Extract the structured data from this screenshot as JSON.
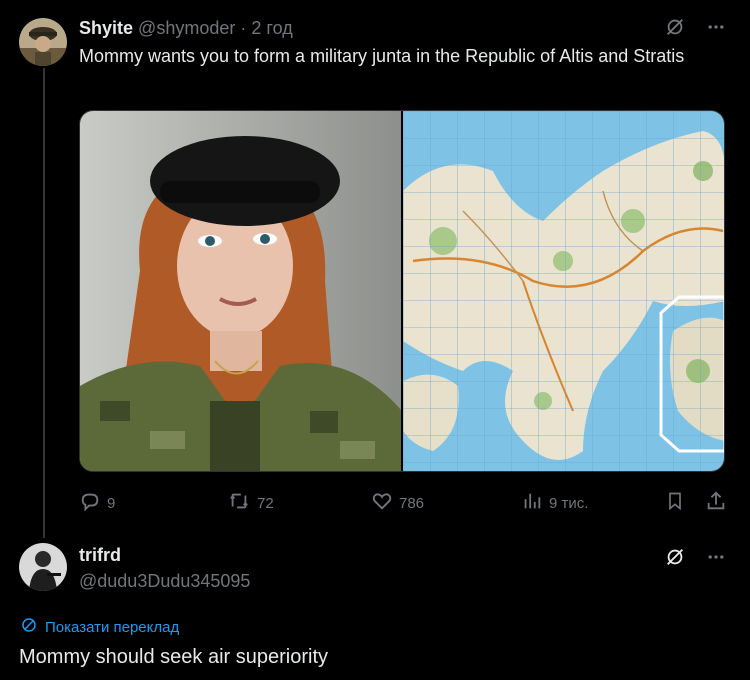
{
  "post": {
    "author_name": "Shyite",
    "author_handle": "@shymoder",
    "separator": "·",
    "time": "2 год",
    "text": "Mommy wants you to form a military junta in the Republic of Altis and Stratis",
    "media": [
      {
        "kind": "photo",
        "subject": "person-in-beret-and-camouflage"
      },
      {
        "kind": "map",
        "subject": "topographic-island-map"
      }
    ],
    "stats": {
      "replies": "9",
      "reposts": "72",
      "likes": "786",
      "views": "9 тис."
    }
  },
  "reply": {
    "author_name": "trifrd",
    "author_handle": "@dudu3Dudu345095",
    "translate_label": "Показати переклад",
    "text": "Mommy should seek air superiority"
  },
  "icons": {
    "grok": "grok-icon",
    "more": "more-icon",
    "reply": "reply-icon",
    "repost": "repost-icon",
    "like": "heart-icon",
    "views": "views-icon",
    "bookmark": "bookmark-icon",
    "share": "share-icon",
    "translate": "globe-icon"
  },
  "colors": {
    "background": "#000000",
    "text": "#e7e9ea",
    "muted": "#71767b",
    "link": "#1d9bf0",
    "divider": "#333639"
  }
}
